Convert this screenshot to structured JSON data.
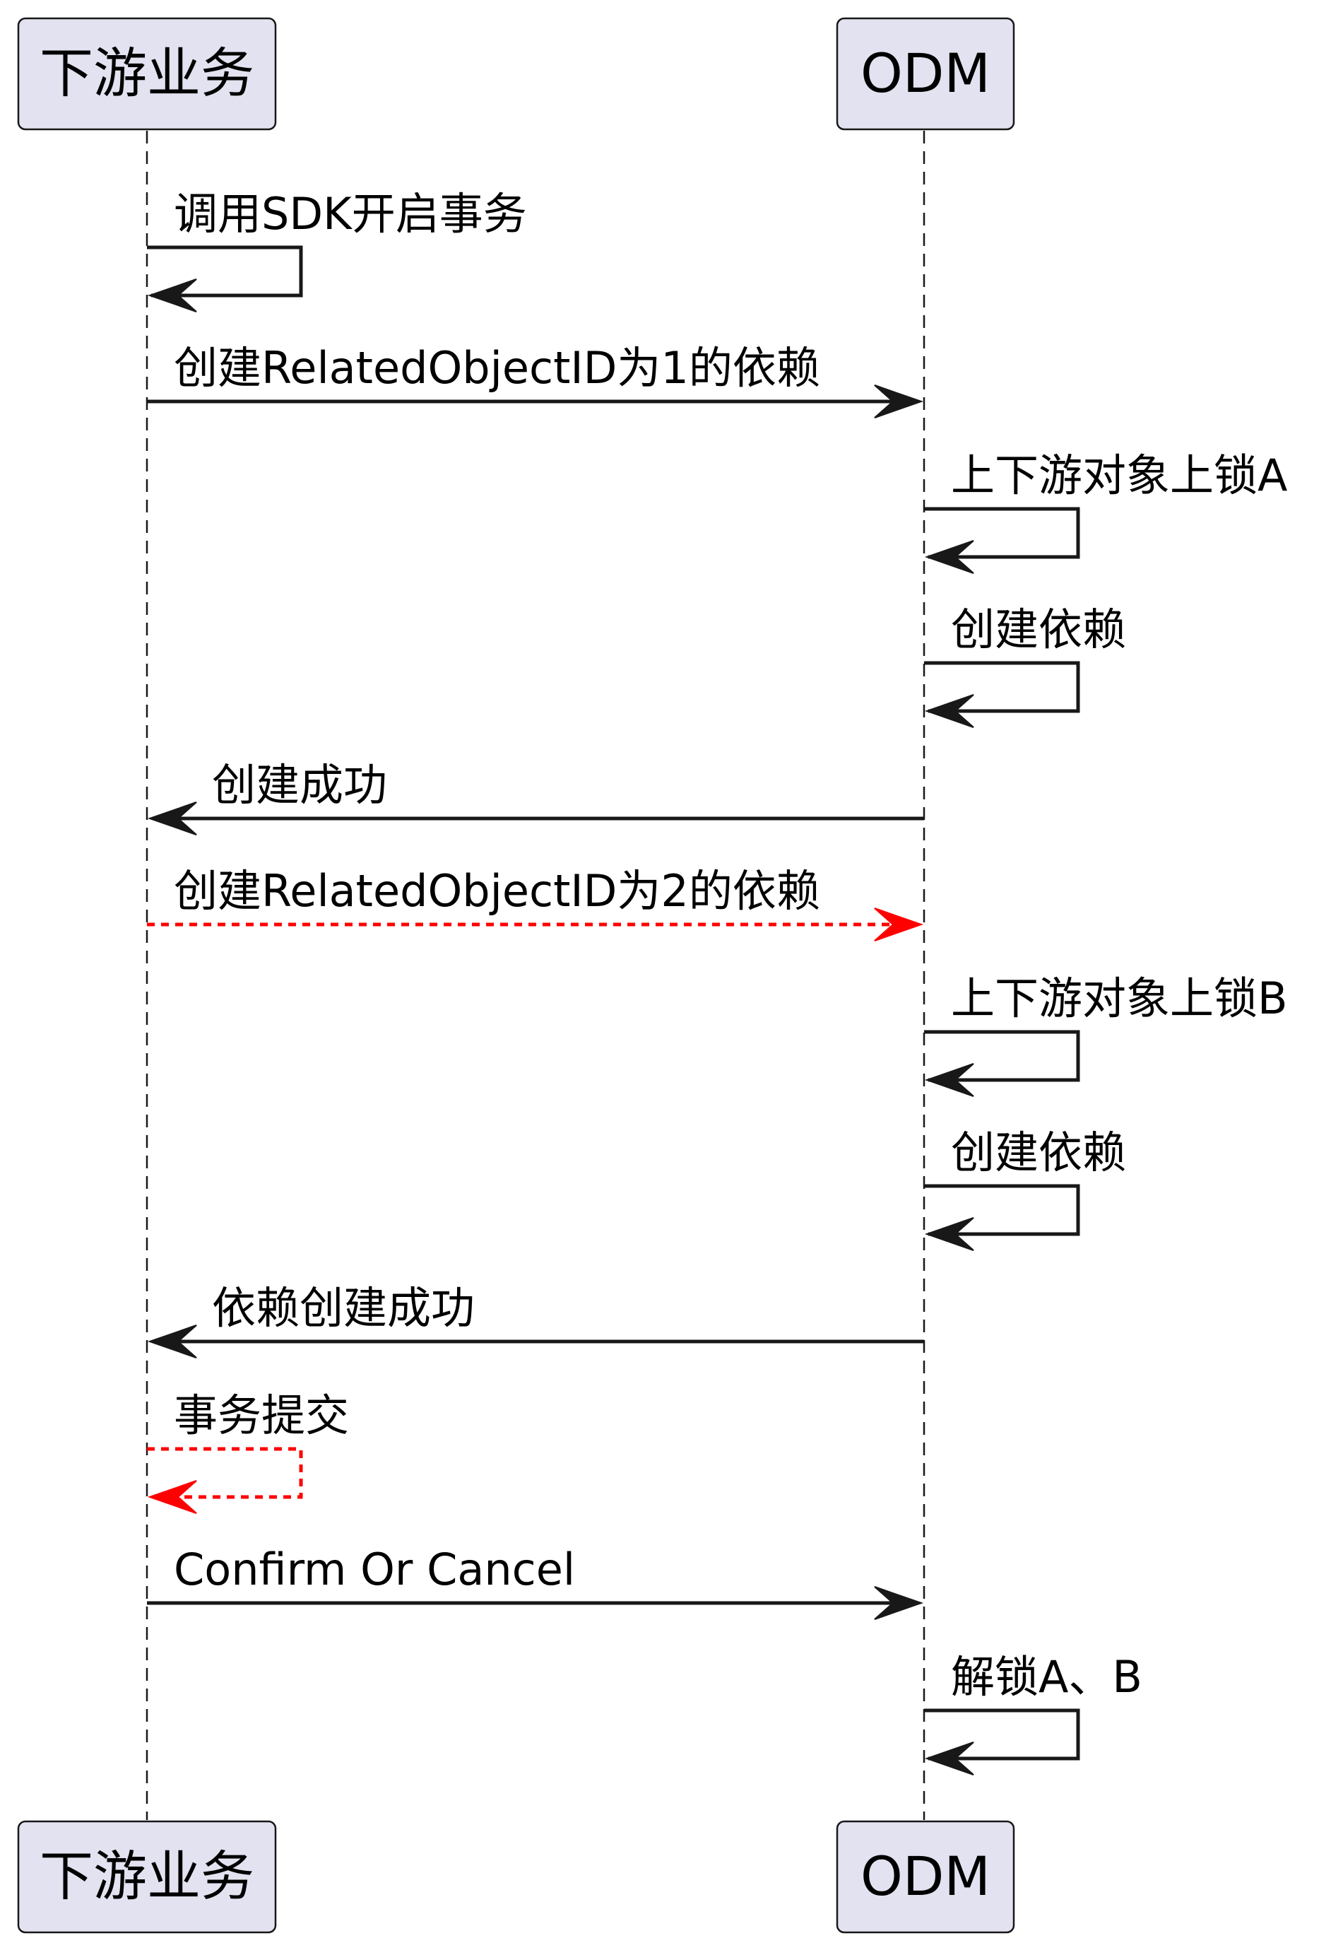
{
  "participants": [
    {
      "id": "downstream",
      "label": "下游业务"
    },
    {
      "id": "odm",
      "label": "ODM"
    }
  ],
  "colors": {
    "box_fill": "#E2E2F0",
    "line": "#181818",
    "async": "#FF0000",
    "text": "#000000"
  },
  "messages": [
    {
      "from": "downstream",
      "to": "downstream",
      "label": "调用SDK开启事务",
      "style": "solid"
    },
    {
      "from": "downstream",
      "to": "odm",
      "label": "创建RelatedObjectID为1的依赖",
      "style": "solid"
    },
    {
      "from": "odm",
      "to": "odm",
      "label": "上下游对象上锁A",
      "style": "solid"
    },
    {
      "from": "odm",
      "to": "odm",
      "label": "创建依赖",
      "style": "solid"
    },
    {
      "from": "odm",
      "to": "downstream",
      "label": "创建成功",
      "style": "solid"
    },
    {
      "from": "downstream",
      "to": "odm",
      "label": "创建RelatedObjectID为2的依赖",
      "style": "dashed-red"
    },
    {
      "from": "odm",
      "to": "odm",
      "label": "上下游对象上锁B",
      "style": "solid"
    },
    {
      "from": "odm",
      "to": "odm",
      "label": "创建依赖",
      "style": "solid"
    },
    {
      "from": "odm",
      "to": "downstream",
      "label": "依赖创建成功",
      "style": "solid"
    },
    {
      "from": "downstream",
      "to": "downstream",
      "label": "事务提交",
      "style": "dashed-red"
    },
    {
      "from": "downstream",
      "to": "odm",
      "label": "Confirm Or Cancel",
      "style": "solid"
    },
    {
      "from": "odm",
      "to": "odm",
      "label": "解锁A、B",
      "style": "solid"
    }
  ]
}
